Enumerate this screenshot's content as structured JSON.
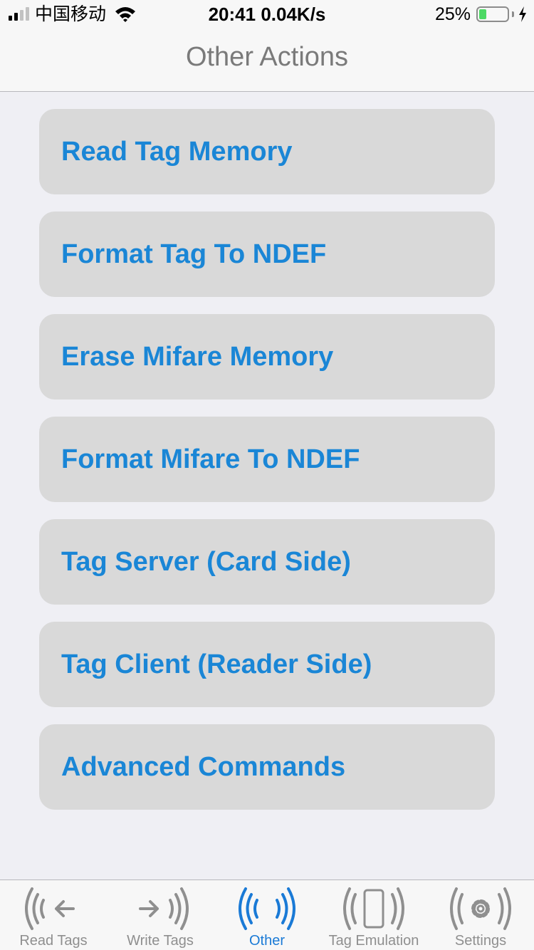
{
  "status_bar": {
    "carrier": "中国移动",
    "time_speed": "20:41 0.04K/s",
    "battery_percent": "25%",
    "battery_level": 0.25,
    "battery_color": "#4cd964",
    "signal_bars_filled": 2,
    "signal_bars_total": 4
  },
  "nav": {
    "title": "Other Actions"
  },
  "actions": [
    {
      "label": "Read Tag Memory"
    },
    {
      "label": "Format Tag To NDEF"
    },
    {
      "label": "Erase Mifare Memory"
    },
    {
      "label": "Format Mifare To NDEF"
    },
    {
      "label": "Tag Server (Card Side)"
    },
    {
      "label": "Tag Client (Reader Side)"
    },
    {
      "label": "Advanced Commands"
    }
  ],
  "colors": {
    "accent": "#1a86d6",
    "tab_active": "#1a7ad6",
    "tab_inactive": "#8f8f8f",
    "button_bg": "#d9d9d9"
  },
  "tabs": [
    {
      "label": "Read Tags",
      "icon": "read-tags-icon",
      "active": false
    },
    {
      "label": "Write Tags",
      "icon": "write-tags-icon",
      "active": false
    },
    {
      "label": "Other",
      "icon": "nfc-waves-icon",
      "active": true
    },
    {
      "label": "Tag Emulation",
      "icon": "phone-emulation-icon",
      "active": false
    },
    {
      "label": "Settings",
      "icon": "gear-icon",
      "active": false
    }
  ]
}
